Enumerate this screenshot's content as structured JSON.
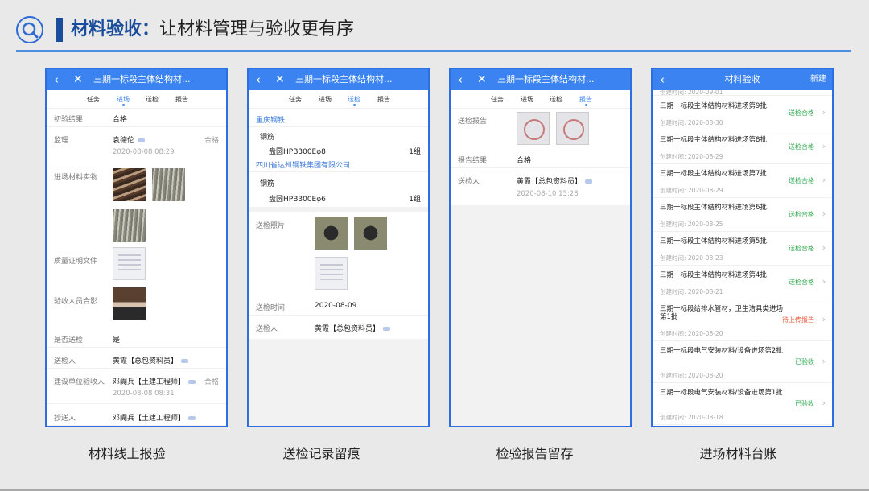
{
  "header": {
    "title_bold": "材料验收：",
    "title_rest": "让材料管理与验收更有序"
  },
  "colors": {
    "accent": "#3a83f0",
    "brand": "#1a4d9c",
    "pass": "#2fa84f",
    "pending": "#e85b3a"
  },
  "tabs": [
    "任务",
    "进场",
    "送检",
    "报告"
  ],
  "screen1": {
    "nav_title": "三期一标段主体结构材...",
    "active_tab": "进场",
    "initial_result_label": "初验结果",
    "initial_result_value": "合格",
    "supervisor_label": "监理",
    "supervisor_name": "袁德伦",
    "supervisor_result": "合格",
    "supervisor_time": "2020-08-08 08:29",
    "photos_label": "进场材料实物",
    "quality_doc_label": "质量证明文件",
    "group_photo_label": "验收人员合影",
    "send_inspect_label": "是否送检",
    "send_inspect_value": "是",
    "sender_label": "送检人",
    "sender_value": "黄霞【总包资料员】",
    "owner_label": "建设单位验收人",
    "owner_value": "邓阗兵【土建工程师】",
    "owner_result": "合格",
    "owner_time": "2020-08-08 08:31",
    "cc_label": "抄送人",
    "cc_value": "邓阗兵【土建工程师】"
  },
  "screen2": {
    "nav_title": "三期一标段主体结构材...",
    "active_tab": "送检",
    "supplier1": "重庆钢铁",
    "material1": "钢筋",
    "spec1": "盘圆HPB300Eφ8",
    "qty1": "1组",
    "supplier2": "四川省达州钢铁集团有限公司",
    "material2": "钢筋",
    "spec2": "盘圆HPB300Eφ6",
    "qty2": "1组",
    "photos_label": "送检照片",
    "time_label": "送检时间",
    "time_value": "2020-08-09",
    "sender_label": "送检人",
    "sender_value": "黄霞【总包资料员】"
  },
  "screen3": {
    "nav_title": "三期一标段主体结构材...",
    "active_tab": "报告",
    "report_label": "送检报告",
    "result_label": "报告结果",
    "result_value": "合格",
    "sender_label": "送检人",
    "sender_value": "黄霞【总包资料员】",
    "sender_time": "2020-08-10 15:28"
  },
  "screen4": {
    "nav_title": "材料验收",
    "nav_right": "新建",
    "top_clipped": "创建时间: 2020-09-01",
    "items": [
      {
        "title": "三期一标段主体结构材料进场第9批",
        "time": "创建时间: 2020-08-30",
        "status": "送检合格",
        "kind": "pass"
      },
      {
        "title": "三期一标段主体结构材料进场第8批",
        "time": "创建时间: 2020-08-29",
        "status": "送检合格",
        "kind": "pass"
      },
      {
        "title": "三期一标段主体结构材料进场第7批",
        "time": "创建时间: 2020-08-29",
        "status": "送检合格",
        "kind": "pass"
      },
      {
        "title": "三期一标段主体结构材料进场第6批",
        "time": "创建时间: 2020-08-25",
        "status": "送检合格",
        "kind": "pass"
      },
      {
        "title": "三期一标段主体结构材料进场第5批",
        "time": "创建时间: 2020-08-23",
        "status": "送检合格",
        "kind": "pass"
      },
      {
        "title": "三期一标段主体结构材料进场第4批",
        "time": "创建时间: 2020-08-21",
        "status": "送检合格",
        "kind": "pass"
      },
      {
        "title": "三期一标段给排水管材，卫生洁具类进场第1批",
        "time": "创建时间: 2020-08-20",
        "status": "待上传报告",
        "kind": "pending"
      },
      {
        "title": "三期一标段电气安装材料/设备进场第2批",
        "time": "创建时间: 2020-08-20",
        "status": "已验收",
        "kind": "pass"
      },
      {
        "title": "三期一标段电气安装材料/设备进场第1批",
        "time": "创建时间: 2020-08-18",
        "status": "已验收",
        "kind": "pass"
      }
    ]
  },
  "captions": [
    "材料线上报验",
    "送检记录留痕",
    "检验报告留存",
    "进场材料台账"
  ]
}
